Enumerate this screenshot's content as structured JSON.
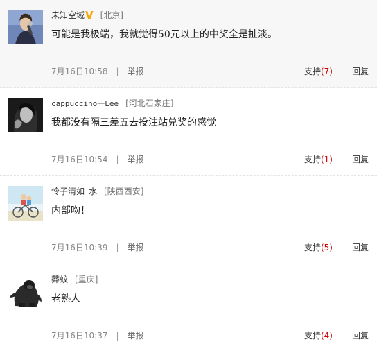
{
  "colors": {
    "accent_count": "#cc0000",
    "vip_badge": "#f5a800",
    "highlight_bg": "#f7f7f7"
  },
  "comments": [
    {
      "username": "未知空域",
      "verified_badge": "V",
      "location": "[北京]",
      "content": "可能是我极端，我就觉得50元以上的中奖全是扯淡。",
      "time": "7月16日10:58",
      "separator": "|",
      "report": "举报",
      "support_label": "支持",
      "support_count": "(7)",
      "reply": "回复",
      "avatar": "musician-avatar-icon"
    },
    {
      "username": "cappuccino一Lee",
      "location": "[河北石家庄]",
      "content": "我都没有隔三差五去投注站兑奖的感觉",
      "time": "7月16日10:54",
      "separator": "|",
      "report": "举报",
      "support_label": "支持",
      "support_count": "(1)",
      "reply": "回复",
      "avatar": "bw-portrait-avatar-icon"
    },
    {
      "username": "怜子清如_水",
      "location": "[陕西西安]",
      "content": "内部吻！",
      "time": "7月16日10:39",
      "separator": "|",
      "report": "举报",
      "support_label": "支持",
      "support_count": "(5)",
      "reply": "回复",
      "avatar": "bicycle-couple-avatar-icon"
    },
    {
      "username": "莽蚊",
      "location": "[重庆]",
      "content": "老熟人",
      "time": "7月16日10:37",
      "separator": "|",
      "report": "举报",
      "support_label": "支持",
      "support_count": "(4)",
      "reply": "回复",
      "avatar": "gorilla-avatar-icon"
    }
  ]
}
